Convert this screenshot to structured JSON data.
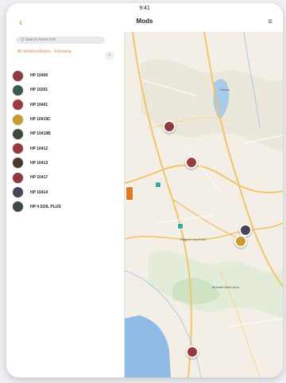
{
  "status": {
    "time": "9:41"
  },
  "nav": {
    "title": "Mods",
    "left_icon": "back-chevron-icon",
    "right_icon": "menu-icon"
  },
  "sidebar": {
    "search_placeholder": "Q  Search Asset Info",
    "filter_text": "All Vehicles/Assets · Following",
    "filter_badge": "×",
    "items": [
      {
        "label": "HP 10400",
        "color": "#8e3b40"
      },
      {
        "label": "HP 10201",
        "color": "#3c5a50"
      },
      {
        "label": "HP 10401",
        "color": "#9a3d42"
      },
      {
        "label": "HP 10419C",
        "color": "#c99a2e"
      },
      {
        "label": "HP 10419B",
        "color": "#3b4a3d"
      },
      {
        "label": "HP 10412",
        "color": "#963a3f"
      },
      {
        "label": "HP 10413",
        "color": "#4a3a2e"
      },
      {
        "label": "HP 10417",
        "color": "#8b3a3f"
      },
      {
        "label": "HP 10414",
        "color": "#4a4458"
      },
      {
        "label": "HP 4 SOIL PLUS",
        "color": "#3e4a48"
      }
    ]
  },
  "map": {
    "pins": [
      {
        "name": "pin-hp10400",
        "color": "#8e3b40"
      },
      {
        "name": "pin-hp10401",
        "color": "#9a3d42"
      },
      {
        "name": "pin-hp10414",
        "color": "#4a4458"
      },
      {
        "name": "pin-hp10419c",
        "color": "#c99a2e"
      },
      {
        "name": "pin-hp10412",
        "color": "#963a3f"
      }
    ],
    "poi_colors": [
      "#3aa6a2",
      "#e4761f"
    ],
    "city_labels": [
      "Nagpur Line Prom",
      "Mumbai Bank Area",
      "Karnal"
    ]
  }
}
